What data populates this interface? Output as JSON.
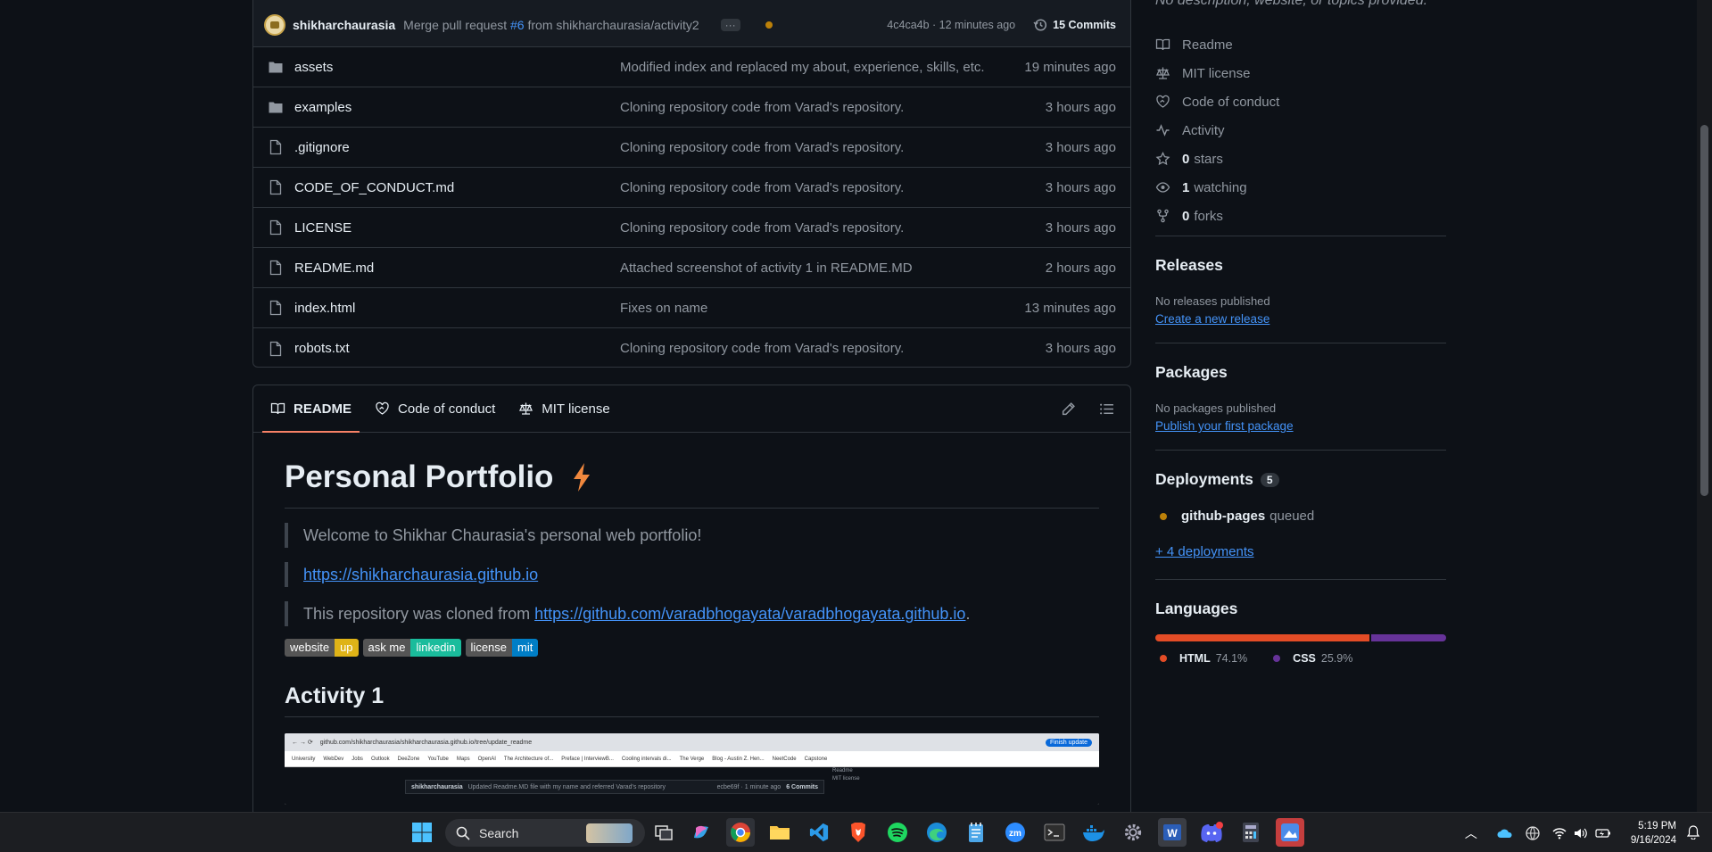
{
  "commit": {
    "author": "shikharchaurasia",
    "message_prefix": "Merge pull request",
    "pr": "#6",
    "message_suffix": "from shikharchaurasia/activity2",
    "hash_time": "4c4ca4b · 12 minutes ago",
    "commits": "15 Commits"
  },
  "files": [
    {
      "type": "folder",
      "name": "assets",
      "message": "Modified index and replaced my about, experience, skills, etc.",
      "time": "19 minutes ago"
    },
    {
      "type": "folder",
      "name": "examples",
      "message": "Cloning repository code from Varad's repository.",
      "time": "3 hours ago"
    },
    {
      "type": "file",
      "name": ".gitignore",
      "message": "Cloning repository code from Varad's repository.",
      "time": "3 hours ago"
    },
    {
      "type": "file",
      "name": "CODE_OF_CONDUCT.md",
      "message": "Cloning repository code from Varad's repository.",
      "time": "3 hours ago"
    },
    {
      "type": "file",
      "name": "LICENSE",
      "message": "Cloning repository code from Varad's repository.",
      "time": "3 hours ago"
    },
    {
      "type": "file",
      "name": "README.md",
      "message": "Attached screenshot of activity 1 in README.MD",
      "time": "2 hours ago"
    },
    {
      "type": "file",
      "name": "index.html",
      "message": "Fixes on name",
      "time": "13 minutes ago"
    },
    {
      "type": "file",
      "name": "robots.txt",
      "message": "Cloning repository code from Varad's repository.",
      "time": "3 hours ago"
    }
  ],
  "readme": {
    "tabs": [
      "README",
      "Code of conduct",
      "MIT license"
    ],
    "title": "Personal Portfolio",
    "welcome": "Welcome to Shikhar Chaurasia's personal web portfolio!",
    "site_link": "https://shikharchaurasia.github.io",
    "cloned_prefix": "This repository was cloned from ",
    "cloned_link": "https://github.com/varadbhogayata/varadbhogayata.github.io",
    "cloned_suffix": ".",
    "badges": [
      {
        "left": "website",
        "right": "up",
        "color": "#dfb317"
      },
      {
        "left": "ask me",
        "right": "linkedin",
        "color": "#1abc9c"
      },
      {
        "left": "license",
        "right": "mit",
        "color": "#007ec6"
      }
    ],
    "activity_heading": "Activity 1",
    "screenshot": {
      "address": "github.com/shikharchaurasia/shikharchaurasia.github.io/tree/update_readme",
      "bookmarks": [
        "University",
        "WebDev",
        "Jobs",
        "Outlook",
        "DeeZone",
        "YouTube",
        "Maps",
        "OpenAI",
        "The Architecture of...",
        "Preface | InterviewB...",
        "Cooling intervals di...",
        "The Verge",
        "Blog - Austin Z. Hen...",
        "NeetCode",
        "Capstone"
      ],
      "author": "shikharchaurasia",
      "message": "Updated Readme.MD file with my name and referred Varad's repository",
      "meta": "ecbe69f · 1 minute ago",
      "commits": "6 Commits",
      "side": [
        "Readme",
        "MIT license"
      ],
      "finish": "Finish update"
    }
  },
  "sidebar": {
    "description": "No description, website, or topics provided.",
    "links": [
      {
        "icon": "book-icon",
        "bold": "",
        "text": "Readme"
      },
      {
        "icon": "scale-icon",
        "bold": "",
        "text": "MIT license"
      },
      {
        "icon": "heart-icon",
        "bold": "",
        "text": "Code of conduct"
      },
      {
        "icon": "pulse-icon",
        "bold": "",
        "text": "Activity"
      },
      {
        "icon": "star-icon",
        "bold": "0",
        "text": "stars"
      },
      {
        "icon": "eye-icon",
        "bold": "1",
        "text": "watching"
      },
      {
        "icon": "fork-icon",
        "bold": "0",
        "text": "forks"
      }
    ],
    "releases": {
      "title": "Releases",
      "none": "No releases published",
      "link": "Create a new release"
    },
    "packages": {
      "title": "Packages",
      "none": "No packages published",
      "link": "Publish your first package"
    },
    "deployments": {
      "title": "Deployments",
      "count": "5",
      "name": "github-pages",
      "status": "queued",
      "more": "+ 4 deployments"
    },
    "languages": {
      "title": "Languages",
      "items": [
        {
          "name": "HTML",
          "percent": "74.1%",
          "value": 74.1,
          "color": "#e34c26"
        },
        {
          "name": "CSS",
          "percent": "25.9%",
          "value": 25.9,
          "color": "#663399"
        }
      ]
    }
  },
  "taskbar": {
    "search": "Search",
    "time": "5:19 PM",
    "date": "9/16/2024"
  }
}
